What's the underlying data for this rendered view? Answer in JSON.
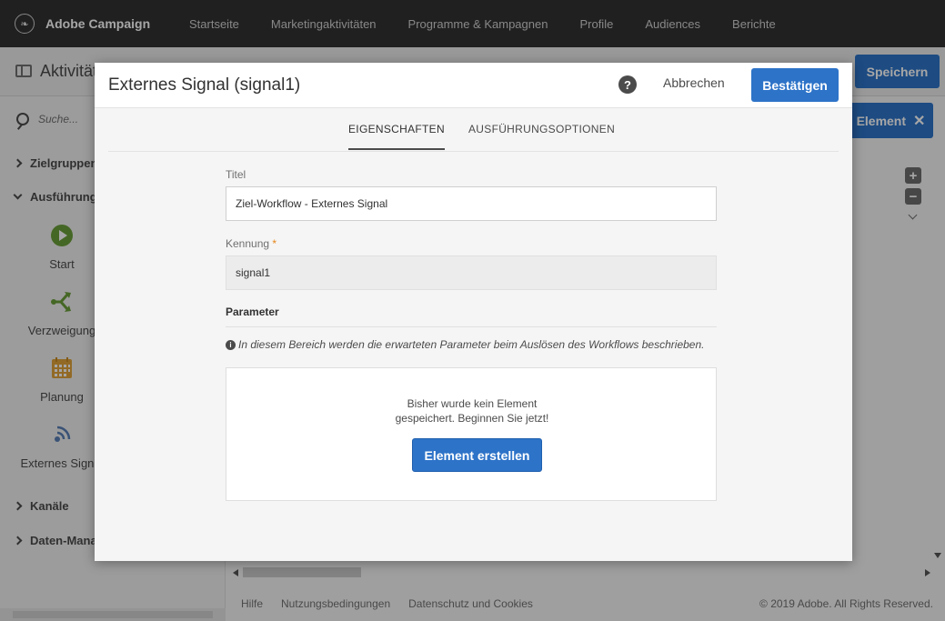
{
  "app": {
    "brand_name": "Adobe Campaign"
  },
  "topnav": {
    "items": [
      {
        "label": "Startseite"
      },
      {
        "label": "Marketingaktivitäten"
      },
      {
        "label": "Programme & Kampagnen"
      },
      {
        "label": "Profile"
      },
      {
        "label": "Audiences"
      },
      {
        "label": "Berichte"
      }
    ]
  },
  "subheader": {
    "title": "Aktivitäten",
    "save_label": "Speichern"
  },
  "sidebar": {
    "search_placeholder": "Suche...",
    "sections": [
      {
        "label": "Zielgruppenbestimmung",
        "expanded": false
      },
      {
        "label": "Ausführung",
        "expanded": true
      },
      {
        "label": "Kanäle",
        "expanded": false
      },
      {
        "label": "Daten-Management",
        "expanded": false
      }
    ],
    "activities": [
      {
        "label": "Start",
        "icon": "play-icon"
      },
      {
        "label": "Verzweigung",
        "icon": "fork-icon"
      },
      {
        "label": "Planung",
        "icon": "calendar-icon"
      },
      {
        "label": "Externes Signal",
        "icon": "signal-icon"
      }
    ]
  },
  "canvas": {
    "element_button_label": "Element"
  },
  "footer": {
    "links": [
      {
        "label": "Hilfe"
      },
      {
        "label": "Nutzungsbedingungen"
      },
      {
        "label": "Datenschutz und Cookies"
      }
    ],
    "copyright": "© 2019 Adobe. All Rights Reserved."
  },
  "modal": {
    "title": "Externes Signal (signal1)",
    "help_symbol": "?",
    "cancel_label": "Abbrechen",
    "confirm_label": "Bestätigen",
    "tabs": [
      {
        "label": "EIGENSCHAFTEN",
        "active": true
      },
      {
        "label": "AUSFÜHRUNGSOPTIONEN",
        "active": false
      }
    ],
    "fields": {
      "title_label": "Titel",
      "title_value": "Ziel-Workflow - Externes Signal",
      "id_label": "Kennung",
      "id_required_mark": "*",
      "id_value": "signal1"
    },
    "parameters": {
      "section_title": "Parameter",
      "info_text": "In diesem Bereich werden die erwarteten Parameter beim Auslösen des Workflows beschrieben.",
      "empty_line1": "Bisher wurde kein Element",
      "empty_line2": "gespeichert. Beginnen Sie jetzt!",
      "create_label": "Element erstellen"
    }
  },
  "colors": {
    "accent": "#2d73c8",
    "topnav_bg": "#323232",
    "required": "#e68619"
  }
}
